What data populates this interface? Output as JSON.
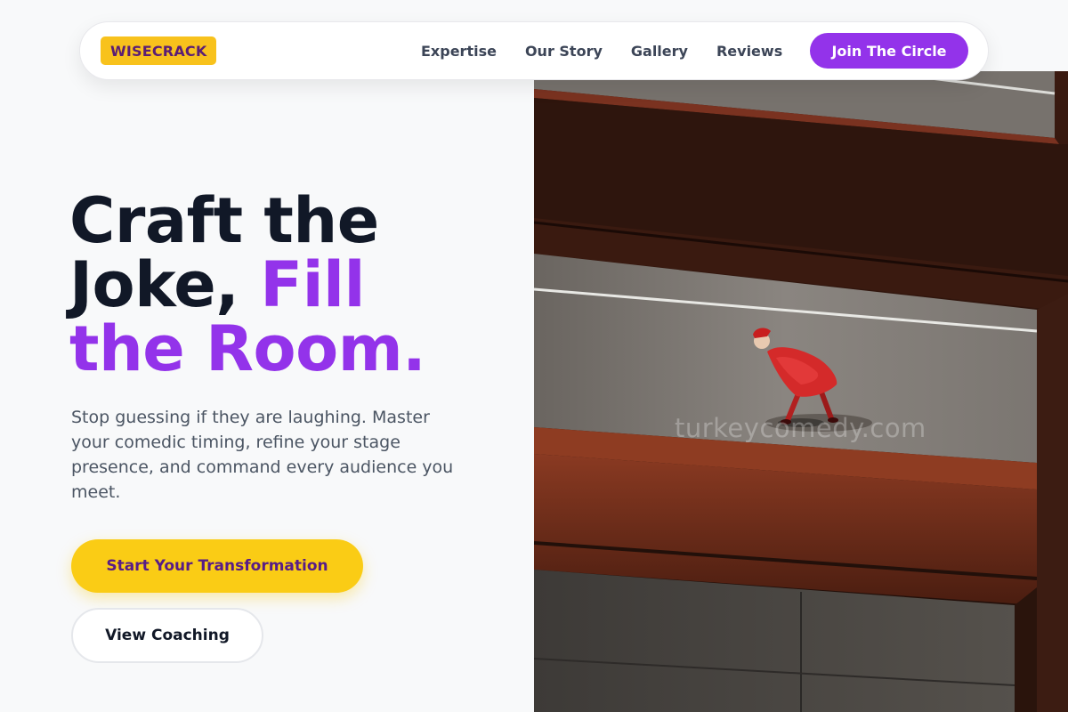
{
  "nav": {
    "logo": "WISECRACK",
    "links": [
      "Expertise",
      "Our Story",
      "Gallery",
      "Reviews"
    ],
    "cta": "Join The Circle"
  },
  "hero": {
    "headline_line1": "Craft the",
    "headline_line2a": "Joke, ",
    "headline_line2b": "Fill",
    "headline_line3": "the Room.",
    "subtitle": "Stop guessing if they are laughing. Master your comedic timing, refine your stage presence, and command every audience you meet.",
    "primary_button": "Start Your Transformation",
    "secondary_button": "View Coaching",
    "image_watermark": "turkeycomedy.com"
  },
  "colors": {
    "accent_purple": "#9333ea",
    "logo_yellow": "#f8c21c",
    "button_yellow": "#facc15",
    "heading_dark": "#111827"
  }
}
